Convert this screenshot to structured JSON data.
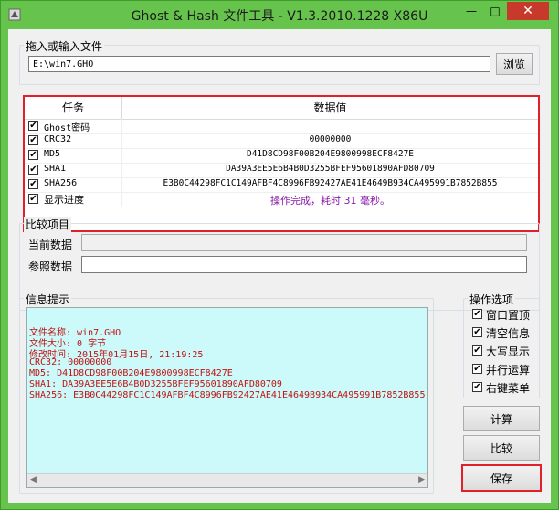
{
  "window": {
    "title": "Ghost & Hash 文件工具 - V1.3.2010.1228 X86U",
    "controls": {
      "minimize": "—",
      "maximize": "□",
      "close": "✕"
    }
  },
  "file_group": {
    "legend": "拖入或输入文件",
    "path_value": "E:\\win7.GHO",
    "browse_label": "浏览"
  },
  "grid": {
    "headers": {
      "task": "任务",
      "value": "数据值"
    },
    "rows": [
      {
        "label": "Ghost密码",
        "value": "",
        "checked": true
      },
      {
        "label": "CRC32",
        "value": "00000000",
        "checked": true
      },
      {
        "label": "MD5",
        "value": "D41D8CD98F00B204E9800998ECF8427E",
        "checked": true
      },
      {
        "label": "SHA1",
        "value": "DA39A3EE5E6B4B0D3255BFEF95601890AFD80709",
        "checked": true
      },
      {
        "label": "SHA256",
        "value": "E3B0C44298FC1C149AFBF4C8996FB92427AE41E4649B934CA495991B7852B855",
        "checked": true
      },
      {
        "label": "显示进度",
        "value": "操作完成，耗时 31 毫秒。",
        "checked": true
      }
    ]
  },
  "compare": {
    "legend": "比较项目",
    "current_label": "当前数据",
    "current_value": "",
    "reference_label": "参照数据",
    "reference_value": ""
  },
  "info": {
    "legend": "信息提示",
    "lines": [
      "文件名称: win7.GHO",
      "文件大小: 0 字节",
      "修改时间: 2015年01月15日, 21:19:25",
      "CRC32: 00000000",
      "MD5: D41D8CD98F00B204E9800998ECF8427E",
      "SHA1: DA39A3EE5E6B4B0D3255BFEF95601890AFD80709",
      "SHA256: E3B0C44298FC1C149AFBF4C8996FB92427AE41E4649B934CA495991B7852B855"
    ]
  },
  "options": {
    "legend": "操作选项",
    "items": [
      {
        "label": "窗口置顶",
        "checked": true
      },
      {
        "label": "清空信息",
        "checked": true
      },
      {
        "label": "大写显示",
        "checked": true
      },
      {
        "label": "并行运算",
        "checked": true
      },
      {
        "label": "右键菜单",
        "checked": true
      }
    ]
  },
  "buttons": {
    "compute": "计算",
    "compare": "比较",
    "save": "保存"
  },
  "colors": {
    "titlebar": "#66c44d",
    "highlight_border": "#e0202a",
    "info_bg": "#ccfafa",
    "info_text": "#c41010",
    "status_text": "#8a1aa8"
  }
}
